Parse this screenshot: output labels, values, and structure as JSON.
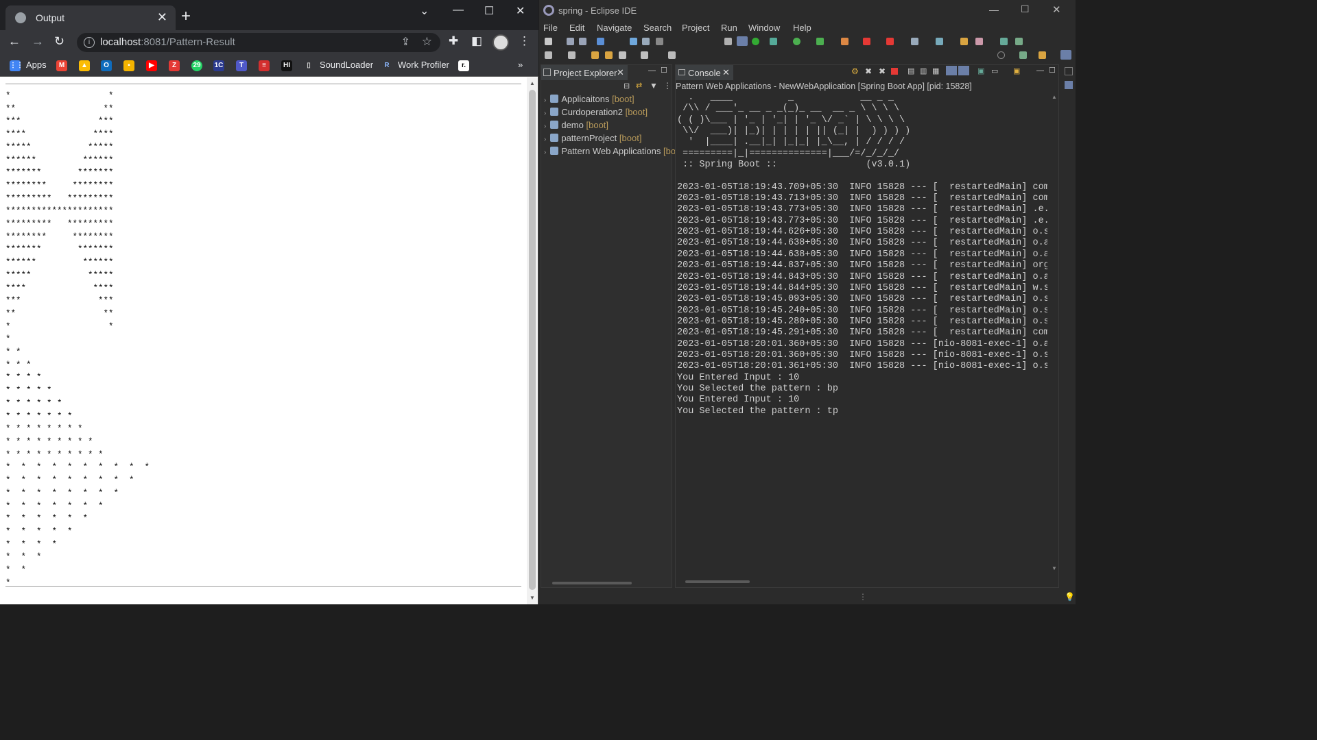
{
  "browser": {
    "tab_title": "Output",
    "tab_close": "✕",
    "new_tab": "+",
    "url_host": "localhost",
    "url_rest": ":8081/Pattern-Result",
    "bookmarks": [
      {
        "label": "Apps"
      },
      {
        "label": "SoundLoader"
      },
      {
        "label": "Work Profiler"
      }
    ],
    "bookmark_overflow": "»",
    "pattern_output": "*                   *\n**                 **\n***               ***\n****             ****\n*****           *****\n******         ******\n*******       *******\n********     ********\n*********   *********\n*********************\n*********   *********\n********     ********\n*******       *******\n******         ******\n*****           *****\n****             ****\n***               ***\n**                 **\n*                   *\n*\n* *\n* * *\n* * * *\n* * * * *\n* * * * * *\n* * * * * * *\n* * * * * * * *\n* * * * * * * * *\n* * * * * * * * * *\n*  *  *  *  *  *  *  *  *  *\n*  *  *  *  *  *  *  *  *\n*  *  *  *  *  *  *  *\n*  *  *  *  *  *  *\n*  *  *  *  *  *\n*  *  *  *  *\n*  *  *  *\n*  *  *\n*  *\n*"
  },
  "eclipse": {
    "window_title": "spring - Eclipse IDE",
    "menu": [
      "File",
      "Edit",
      "Navigate",
      "Search",
      "Project",
      "Run",
      "Window",
      "Help"
    ],
    "project_explorer_title": "Project Explorer",
    "projects": [
      {
        "name": "Applicaitons",
        "tag": "[boot]"
      },
      {
        "name": "Curdoperation2",
        "tag": "[boot]"
      },
      {
        "name": "demo",
        "tag": "[boot]"
      },
      {
        "name": "patternProject",
        "tag": "[boot]"
      },
      {
        "name": "Pattern Web Applications",
        "tag": "[bo"
      }
    ],
    "console_title": "Console",
    "console_description": "Pattern Web Applications - NewWebApplication [Spring Boot App]  [pid: 15828]",
    "console_output": "  .   ____          _            __ _ _\n /\\\\ / ___'_ __ _ _(_)_ __  __ _ \\ \\ \\ \\\n( ( )\\___ | '_ | '_| | '_ \\/ _` | \\ \\ \\ \\\n \\\\/  ___)| |_)| | | | | || (_| |  ) ) ) )\n  '  |____| .__|_| |_|_| |_\\__, | / / / /\n =========|_|==============|___/=/_/_/_/\n :: Spring Boot ::                (v3.0.1)\n\n2023-01-05T18:19:43.709+05:30  INFO 15828 --- [  restartedMain] com\n2023-01-05T18:19:43.713+05:30  INFO 15828 --- [  restartedMain] com\n2023-01-05T18:19:43.773+05:30  INFO 15828 --- [  restartedMain] .e.\n2023-01-05T18:19:43.773+05:30  INFO 15828 --- [  restartedMain] .e.\n2023-01-05T18:19:44.626+05:30  INFO 15828 --- [  restartedMain] o.s\n2023-01-05T18:19:44.638+05:30  INFO 15828 --- [  restartedMain] o.a\n2023-01-05T18:19:44.638+05:30  INFO 15828 --- [  restartedMain] o.a\n2023-01-05T18:19:44.837+05:30  INFO 15828 --- [  restartedMain] org\n2023-01-05T18:19:44.843+05:30  INFO 15828 --- [  restartedMain] o.a\n2023-01-05T18:19:44.844+05:30  INFO 15828 --- [  restartedMain] w.s\n2023-01-05T18:19:45.093+05:30  INFO 15828 --- [  restartedMain] o.s\n2023-01-05T18:19:45.240+05:30  INFO 15828 --- [  restartedMain] o.s\n2023-01-05T18:19:45.280+05:30  INFO 15828 --- [  restartedMain] o.s\n2023-01-05T18:19:45.291+05:30  INFO 15828 --- [  restartedMain] com\n2023-01-05T18:20:01.360+05:30  INFO 15828 --- [nio-8081-exec-1] o.a\n2023-01-05T18:20:01.360+05:30  INFO 15828 --- [nio-8081-exec-1] o.s\n2023-01-05T18:20:01.361+05:30  INFO 15828 --- [nio-8081-exec-1] o.s\nYou Entered Input : 10\nYou Selected the pattern : bp\nYou Entered Input : 10\nYou Selected the pattern : tp"
  }
}
